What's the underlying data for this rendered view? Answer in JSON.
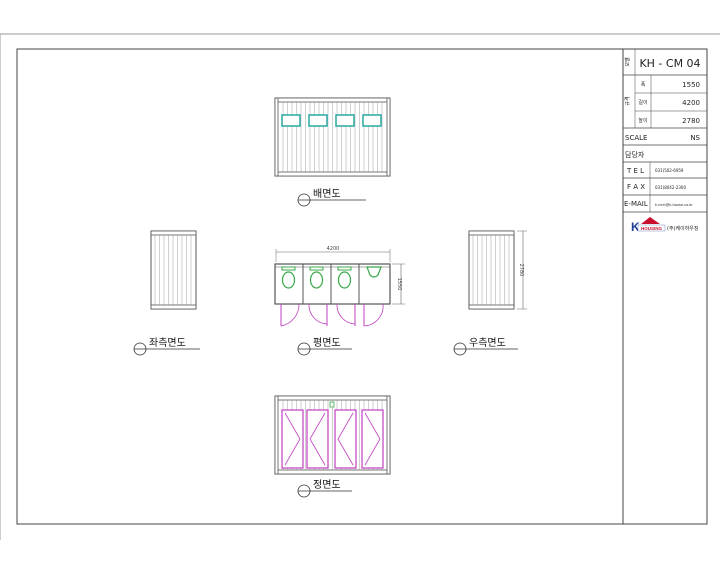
{
  "title_block": {
    "model_label": "모델",
    "model": "KH - CM 04",
    "size_label": "규격",
    "rows": [
      {
        "label": "폭",
        "value": "1550"
      },
      {
        "label": "길이",
        "value": "4200"
      },
      {
        "label": "높이",
        "value": "2780"
      }
    ],
    "scale_label": "SCALE",
    "scale_value": "NS",
    "manager_label": "담당자",
    "tel_label": "T E L",
    "tel_value": "031)502-6959",
    "fax_label": "F A X",
    "fax_value": "031)8042-2300",
    "email_label": "E-MAIL",
    "email_value": "k.cmh@k-house.co.kr",
    "logo_text": "HOUSING",
    "logo_letter": "K",
    "company": "(주)케이하우징"
  },
  "views": {
    "rear": "배면도",
    "left": "좌측면도",
    "plan": "평면도",
    "right": "우측면도",
    "front": "정면도"
  },
  "dimensions": {
    "plan_width": "4200",
    "plan_depth": "1550",
    "side_height": "2780"
  },
  "colors": {
    "window": "#2aa8a0",
    "door": "#c040c0",
    "fixture": "#3aa84a",
    "line": "#555555"
  }
}
